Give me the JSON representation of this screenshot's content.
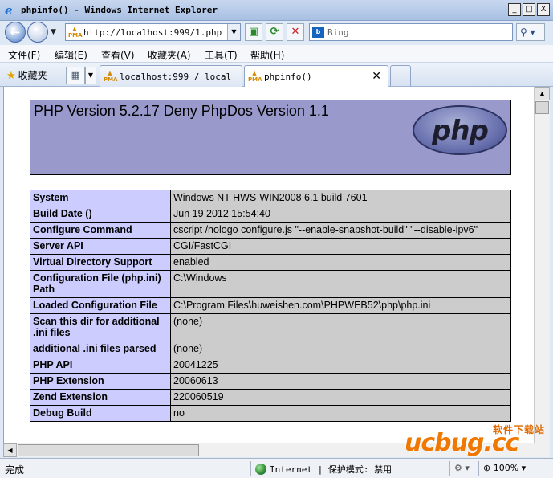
{
  "window": {
    "title": "phpinfo() - Windows Internet Explorer",
    "minimize_glyph": "_",
    "maximize_glyph": "□",
    "close_glyph": "X"
  },
  "nav": {
    "back_glyph": "←",
    "forward_glyph": "→",
    "url": "http://localhost:999/1.php",
    "search_placeholder": "Bing",
    "search_go_glyph": "⚲"
  },
  "menu": {
    "items": [
      "文件(F)",
      "编辑(E)",
      "查看(V)",
      "收藏夹(A)",
      "工具(T)",
      "帮助(H)"
    ]
  },
  "favorites": {
    "label": "收藏夹"
  },
  "tabs": [
    {
      "label": "localhost:999 / local...",
      "icon": "pma-icon"
    },
    {
      "label": "phpinfo()",
      "icon": "pma-icon",
      "active": true,
      "close_glyph": "✕"
    }
  ],
  "php": {
    "version_text": "PHP Version 5.2.17 Deny PhpDos Version 1.1",
    "logo_text": "php",
    "rows": [
      {
        "key": "System",
        "value": "Windows NT HWS-WIN2008 6.1 build 7601"
      },
      {
        "key": "Build Date ()",
        "value": "Jun 19 2012 15:54:40"
      },
      {
        "key": "Configure Command",
        "value": "cscript /nologo configure.js \"--enable-snapshot-build\" \"--disable-ipv6\""
      },
      {
        "key": "Server API",
        "value": "CGI/FastCGI"
      },
      {
        "key": "Virtual Directory Support",
        "value": "enabled"
      },
      {
        "key": "Configuration File (php.ini) Path",
        "value": "C:\\Windows"
      },
      {
        "key": "Loaded Configuration File",
        "value": "C:\\Program Files\\huweishen.com\\PHPWEB52\\php\\php.ini"
      },
      {
        "key": "Scan this dir for additional .ini files",
        "value": "(none)"
      },
      {
        "key": "additional .ini files parsed",
        "value": "(none)"
      },
      {
        "key": "PHP API",
        "value": "20041225"
      },
      {
        "key": "PHP Extension",
        "value": "20060613"
      },
      {
        "key": "Zend Extension",
        "value": "220060519"
      },
      {
        "key": "Debug Build",
        "value": "no"
      }
    ]
  },
  "status": {
    "text": "完成",
    "zone": "Internet | 保护模式: 禁用",
    "zoom": "100%"
  },
  "watermark": {
    "brand": "ucbug.cc",
    "cn": "软件下载站"
  }
}
